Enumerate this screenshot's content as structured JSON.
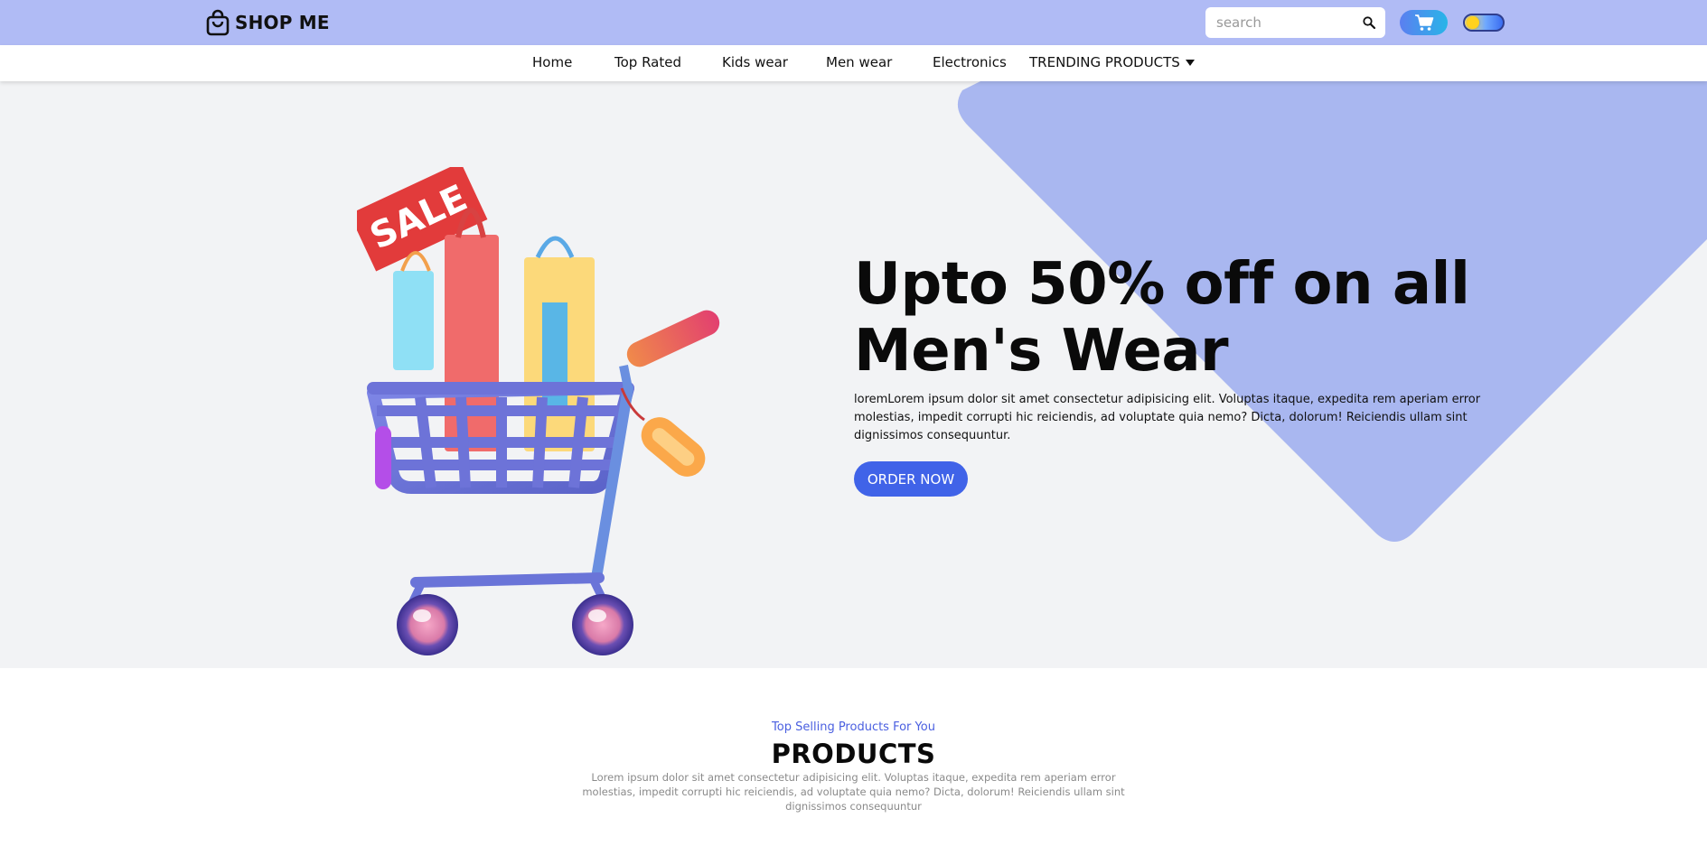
{
  "header": {
    "brand": "SHOP ME",
    "search": {
      "placeholder": "search",
      "value": ""
    }
  },
  "nav": {
    "items": [
      {
        "label": "Home"
      },
      {
        "label": "Top Rated"
      },
      {
        "label": "Kids wear"
      },
      {
        "label": "Men wear"
      },
      {
        "label": "Electronics"
      }
    ],
    "dropdown": {
      "label": "TRENDING PRODUCTS"
    }
  },
  "hero": {
    "title_line1": "Upto 50% off on all",
    "title_line2": "Men's Wear",
    "description": "loremLorem ipsum dolor sit amet consectetur adipisicing elit. Voluptas itaque, expedita rem aperiam error molestias, impedit corrupti hic reiciendis, ad voluptate quia nemo? Dicta, dolorum! Reiciendis ullam sint dignissimos consequuntur.",
    "cta": "ORDER NOW",
    "sale_tag": "SALE"
  },
  "products": {
    "subtitle": "Top Selling Products For You",
    "title": "PRODUCTS",
    "description": "Lorem ipsum dolor sit amet consectetur adipisicing elit. Voluptas itaque, expedita rem aperiam error molestias, impedit corrupti hic reiciendis, ad voluptate quia nemo? Dicta, dolorum! Reiciendis ullam sint dignissimos consequuntur"
  },
  "icons": {
    "logo": "shopping-bag-icon",
    "search": "search-icon",
    "cart": "cart-icon",
    "theme": "theme-toggle",
    "caret": "caret-down-icon"
  },
  "colors": {
    "topbar": "#b0bbf5",
    "accent": "#4063e8",
    "hero_shape": "#a9b7f0",
    "hero_bg": "#f2f3f5"
  }
}
